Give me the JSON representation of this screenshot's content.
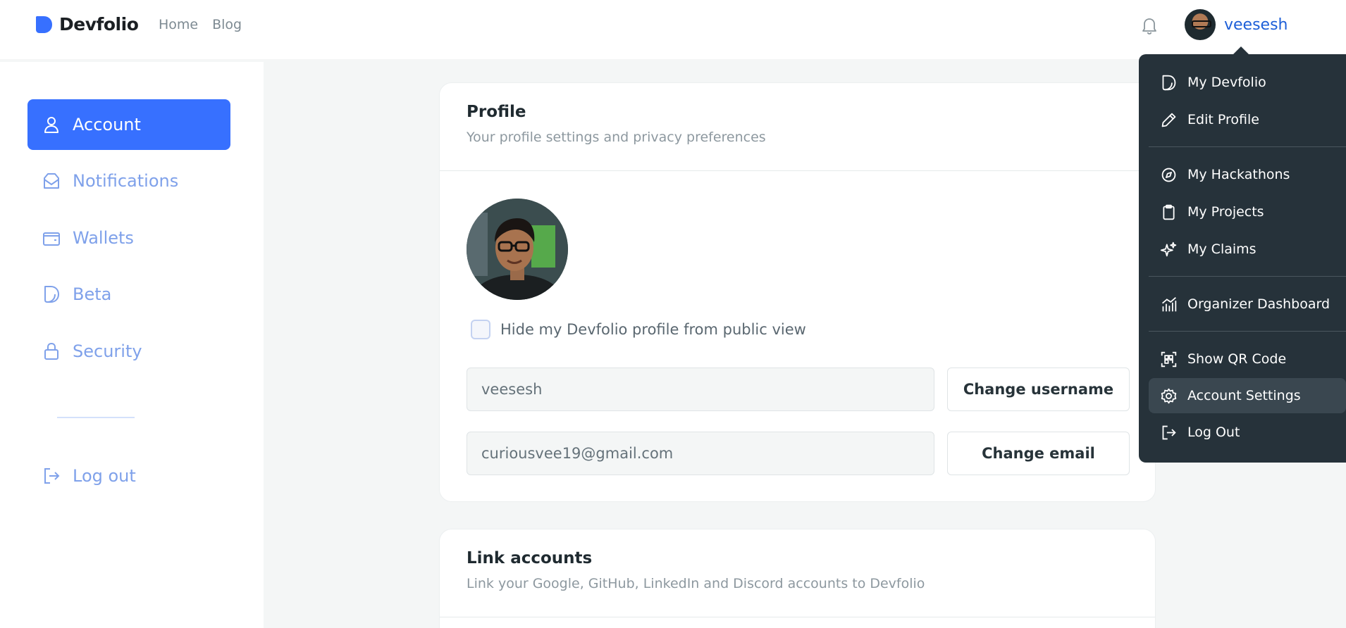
{
  "header": {
    "logo_text": "Devfolio",
    "nav": [
      "Home",
      "Blog"
    ],
    "user_name": "veesesh"
  },
  "sidebar": {
    "items": [
      {
        "label": "Account",
        "icon": "user-icon",
        "active": true
      },
      {
        "label": "Notifications",
        "icon": "inbox-icon"
      },
      {
        "label": "Wallets",
        "icon": "wallet-icon"
      },
      {
        "label": "Beta",
        "icon": "devfolio-icon"
      },
      {
        "label": "Security",
        "icon": "lock-icon"
      }
    ],
    "logout_label": "Log out"
  },
  "profile": {
    "title": "Profile",
    "subtitle": "Your profile settings and privacy preferences",
    "hide_profile_label": "Hide my Devfolio profile from public view",
    "username_value": "veesesh",
    "change_username_label": "Change username",
    "email_value": "curiousvee19@gmail.com",
    "change_email_label": "Change email"
  },
  "link_accounts": {
    "title": "Link accounts",
    "subtitle": "Link your Google, GitHub, LinkedIn and Discord accounts to Devfolio"
  },
  "dropdown": {
    "items": [
      {
        "label": "My Devfolio",
        "icon": "devfolio-icon"
      },
      {
        "label": "Edit Profile",
        "icon": "pencil-icon"
      },
      {
        "label": "My Hackathons",
        "icon": "compass-icon"
      },
      {
        "label": "My Projects",
        "icon": "clipboard-icon"
      },
      {
        "label": "My Claims",
        "icon": "sparkle-icon"
      },
      {
        "label": "Organizer Dashboard",
        "icon": "chart-icon"
      },
      {
        "label": "Show QR Code",
        "icon": "qr-code-icon"
      },
      {
        "label": "Account Settings",
        "icon": "gear-icon",
        "highlighted": true
      },
      {
        "label": "Log Out",
        "icon": "logout-icon"
      }
    ]
  },
  "colors": {
    "accent": "#3770ff",
    "sidebar_text": "#7fa1ea",
    "dropdown_bg": "#26323a",
    "username_link": "#1d5fd8"
  }
}
